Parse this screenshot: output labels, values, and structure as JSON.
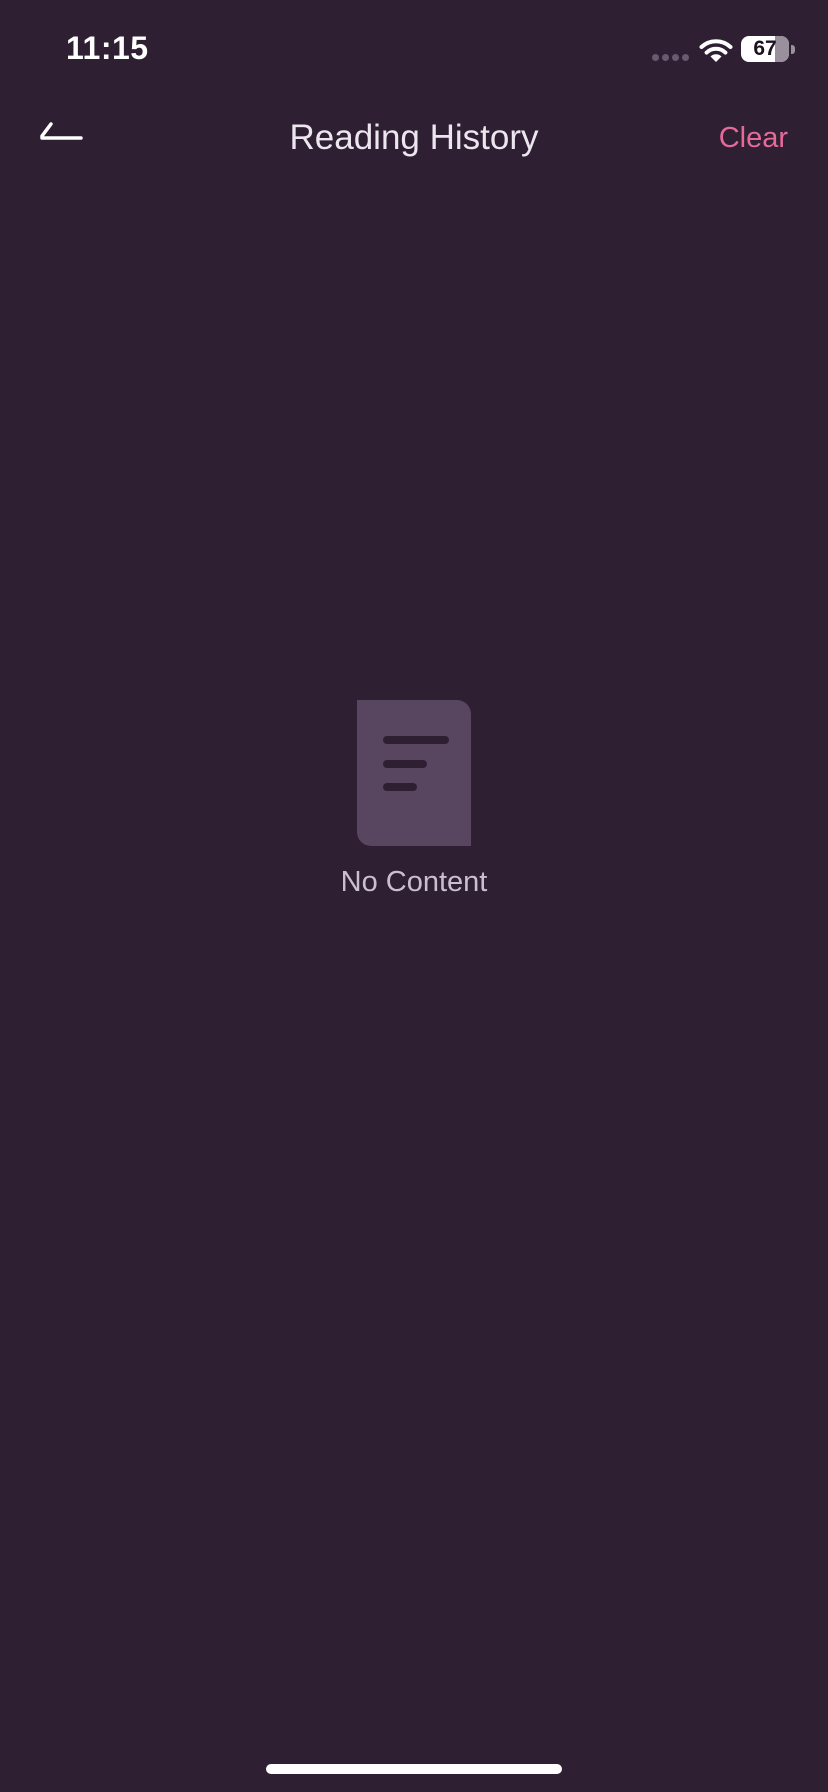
{
  "status_bar": {
    "time": "11:15",
    "battery_percent": "67"
  },
  "nav": {
    "title": "Reading History",
    "clear_label": "Clear",
    "back_icon": "back-arrow-icon"
  },
  "empty_state": {
    "icon": "document-icon",
    "message": "No Content"
  },
  "colors": {
    "background": "#2e1f33",
    "accent": "#e66a97",
    "icon_fill": "#58455f"
  }
}
